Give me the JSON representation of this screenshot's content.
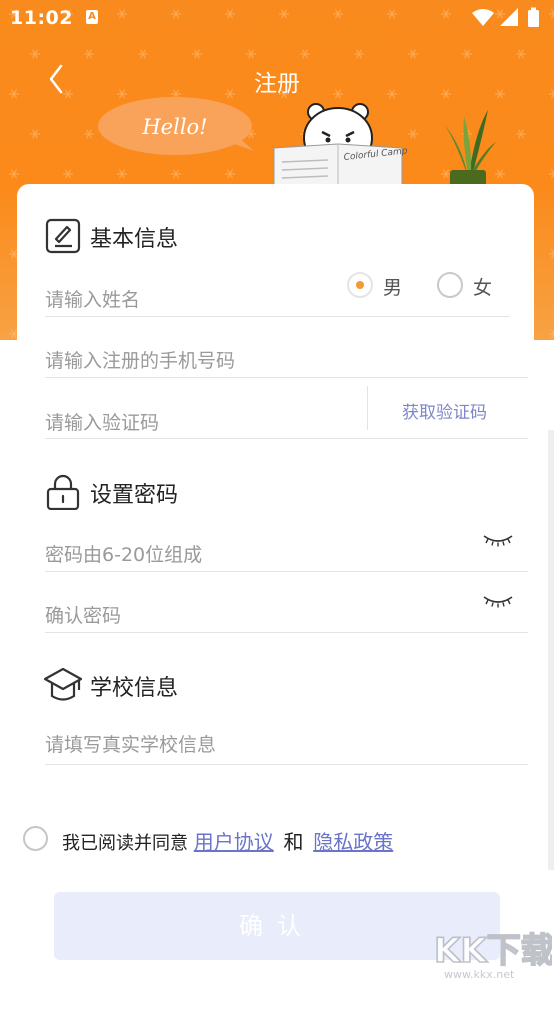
{
  "status_bar": {
    "time": "11:02",
    "notification_glyph": "A",
    "icons": [
      "wifi-icon",
      "signal-icon",
      "battery-icon"
    ]
  },
  "header": {
    "title": "注册",
    "bubble_text": "Hello!",
    "newspaper_text": "Colorful Campus",
    "colors": {
      "orange": "#f98a1d",
      "bubble": "#f9a25a"
    }
  },
  "basic_info": {
    "title": "基本信息",
    "name_placeholder": "请输入姓名",
    "gender": {
      "male": "男",
      "female": "女",
      "selected": "男"
    },
    "phone_placeholder": "请输入注册的手机号码",
    "code_placeholder": "请输入验证码",
    "get_code": "获取验证码"
  },
  "password": {
    "title": "设置密码",
    "password_placeholder": "密码由6-20位组成",
    "confirm_placeholder": "确认密码"
  },
  "school": {
    "title": "学校信息",
    "school_placeholder": "请填写真实学校信息"
  },
  "agreement": {
    "prefix": "我已阅读并同意",
    "user_agreement": "用户协议",
    "and": "和",
    "privacy_policy": "隐私政策"
  },
  "confirm_button": "确认",
  "watermark": {
    "text": "KK下载",
    "url": "www.kkx.net"
  },
  "colors": {
    "link": "#6a74c9",
    "accent": "#f39a32",
    "button_bg": "#e9ecfb"
  }
}
